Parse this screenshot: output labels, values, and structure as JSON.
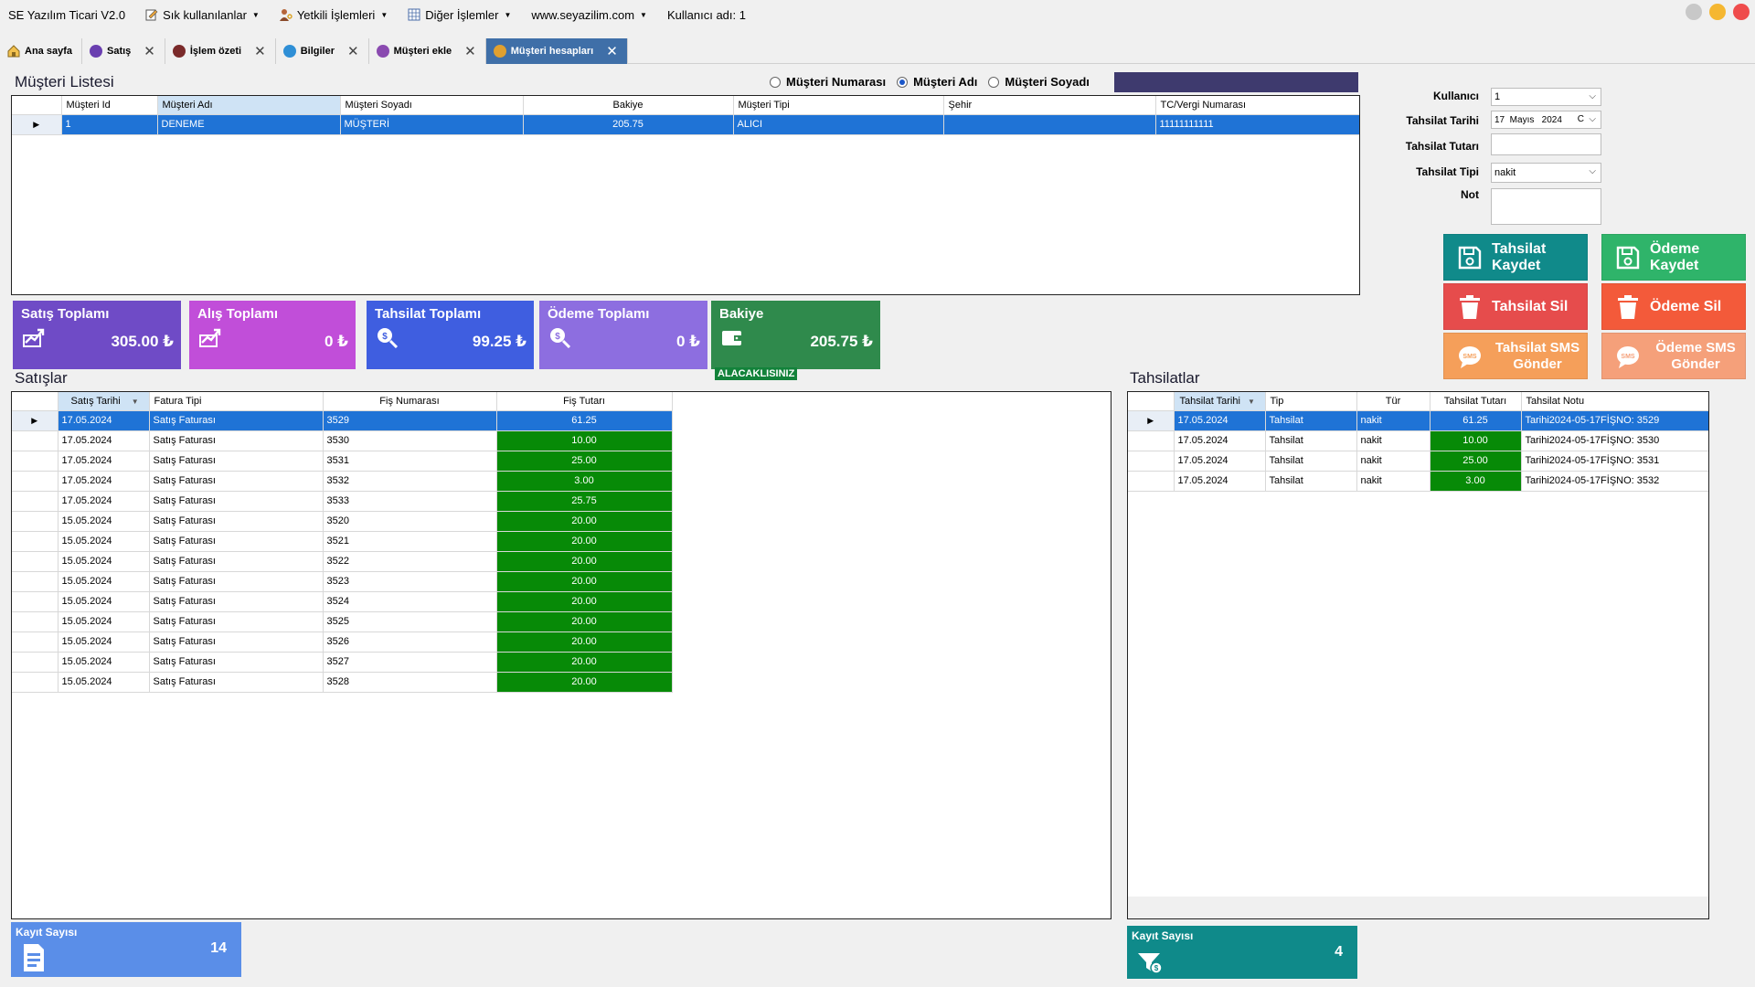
{
  "menubar": {
    "app_title": "SE Yazılım Ticari V2.0",
    "items": [
      {
        "label": "Sık kullanılanlar"
      },
      {
        "label": "Yetkili İşlemleri"
      },
      {
        "label": "Diğer İşlemler"
      },
      {
        "label": "www.seyazilim.com"
      }
    ],
    "user_label": "Kullanıcı adı: 1"
  },
  "tabs": [
    {
      "label": "Ana sayfa",
      "icon": "home-icon",
      "closable": false,
      "active": false
    },
    {
      "label": "Satış",
      "icon": "sales-icon",
      "closable": true,
      "active": false
    },
    {
      "label": "İşlem özeti",
      "icon": "summary-icon",
      "closable": true,
      "active": false
    },
    {
      "label": "Bilgiler",
      "icon": "info-icon",
      "closable": true,
      "active": false
    },
    {
      "label": "Müşteri ekle",
      "icon": "add-customer-icon",
      "closable": true,
      "active": false
    },
    {
      "label": "Müşteri hesapları",
      "icon": "customer-accounts-icon",
      "closable": true,
      "active": true
    }
  ],
  "customer_list": {
    "title": "Müşteri Listesi",
    "search_options": [
      {
        "label": "Müşteri Numarası",
        "checked": false
      },
      {
        "label": "Müşteri Adı",
        "checked": true
      },
      {
        "label": "Müşteri Soyadı",
        "checked": false
      }
    ],
    "columns": [
      "Müşteri Id",
      "Müşteri Adı",
      "Müşteri Soyadı",
      "Bakiye",
      "Müşteri Tipi",
      "Şehir",
      "TC/Vergi Numarası"
    ],
    "rows": [
      [
        "1",
        "DENEME",
        "MÜŞTERİ",
        "205.75",
        "ALICI",
        "",
        "11111111111"
      ]
    ]
  },
  "stats": [
    {
      "title": "Satış Toplamı",
      "value": "305.00 ₺",
      "color": "#6f4bc6",
      "icon": "chart-up-icon"
    },
    {
      "title": "Alış Toplamı",
      "value": "0 ₺",
      "color": "#c14ed9",
      "icon": "chart-up-icon"
    },
    {
      "title": "Tahsilat Toplamı",
      "value": "99.25 ₺",
      "color": "#3f5ee0",
      "icon": "money-search-icon"
    },
    {
      "title": "Ödeme Toplamı",
      "value": "0 ₺",
      "color": "#8d6ee0",
      "icon": "money-search-icon"
    },
    {
      "title": "Bakiye",
      "value": "205.75 ₺",
      "color": "#2f8a4c",
      "icon": "wallet-icon"
    }
  ],
  "balance_status": "ALACAKLISINIZ",
  "form": {
    "user_label": "Kullanıcı",
    "user_value": "1",
    "date_label": "Tahsilat Tarihi",
    "date_value": "17  Mayıs   2024",
    "date_suffix": "C",
    "amount_label": "Tahsilat Tutarı",
    "amount_value": "",
    "type_label": "Tahsilat Tipi",
    "type_value": "nakit",
    "note_label": "Not",
    "note_value": ""
  },
  "buttons": {
    "tahsilat_kaydet": "Tahsilat Kaydet",
    "odeme_kaydet": "Ödeme Kaydet",
    "tahsilat_sil": "Tahsilat Sil",
    "odeme_sil": "Ödeme Sil",
    "tahsilat_sms": "Tahsilat SMS Gönder",
    "odeme_sms": "Ödeme SMS Gönder",
    "sms_icon_text": "SMS"
  },
  "sales": {
    "title": "Satışlar",
    "columns": [
      "Satış Tarihi",
      "Fatura Tipi",
      "Fiş Numarası",
      "Fiş Tutarı"
    ],
    "rows": [
      [
        "17.05.2024",
        "Satış Faturası",
        "3529",
        "61.25"
      ],
      [
        "17.05.2024",
        "Satış Faturası",
        "3530",
        "10.00"
      ],
      [
        "17.05.2024",
        "Satış Faturası",
        "3531",
        "25.00"
      ],
      [
        "17.05.2024",
        "Satış Faturası",
        "3532",
        "3.00"
      ],
      [
        "17.05.2024",
        "Satış Faturası",
        "3533",
        "25.75"
      ],
      [
        "15.05.2024",
        "Satış Faturası",
        "3520",
        "20.00"
      ],
      [
        "15.05.2024",
        "Satış Faturası",
        "3521",
        "20.00"
      ],
      [
        "15.05.2024",
        "Satış Faturası",
        "3522",
        "20.00"
      ],
      [
        "15.05.2024",
        "Satış Faturası",
        "3523",
        "20.00"
      ],
      [
        "15.05.2024",
        "Satış Faturası",
        "3524",
        "20.00"
      ],
      [
        "15.05.2024",
        "Satış Faturası",
        "3525",
        "20.00"
      ],
      [
        "15.05.2024",
        "Satış Faturası",
        "3526",
        "20.00"
      ],
      [
        "15.05.2024",
        "Satış Faturası",
        "3527",
        "20.00"
      ],
      [
        "15.05.2024",
        "Satış Faturası",
        "3528",
        "20.00"
      ]
    ],
    "count_label": "Kayıt Sayısı",
    "count": "14"
  },
  "collections": {
    "title": "Tahsilatlar",
    "columns": [
      "Tahsilat Tarihi",
      "Tip",
      "Tür",
      "Tahsilat Tutarı",
      "Tahsilat Notu"
    ],
    "rows": [
      [
        "17.05.2024",
        "Tahsilat",
        "nakit",
        "61.25",
        "Tarihi2024-05-17FİŞNO: 3529"
      ],
      [
        "17.05.2024",
        "Tahsilat",
        "nakit",
        "10.00",
        "Tarihi2024-05-17FİŞNO: 3530"
      ],
      [
        "17.05.2024",
        "Tahsilat",
        "nakit",
        "25.00",
        "Tarihi2024-05-17FİŞNO: 3531"
      ],
      [
        "17.05.2024",
        "Tahsilat",
        "nakit",
        "3.00",
        "Tarihi2024-05-17FİŞNO: 3532"
      ]
    ],
    "count_label": "Kayıt Sayısı",
    "count": "4"
  }
}
